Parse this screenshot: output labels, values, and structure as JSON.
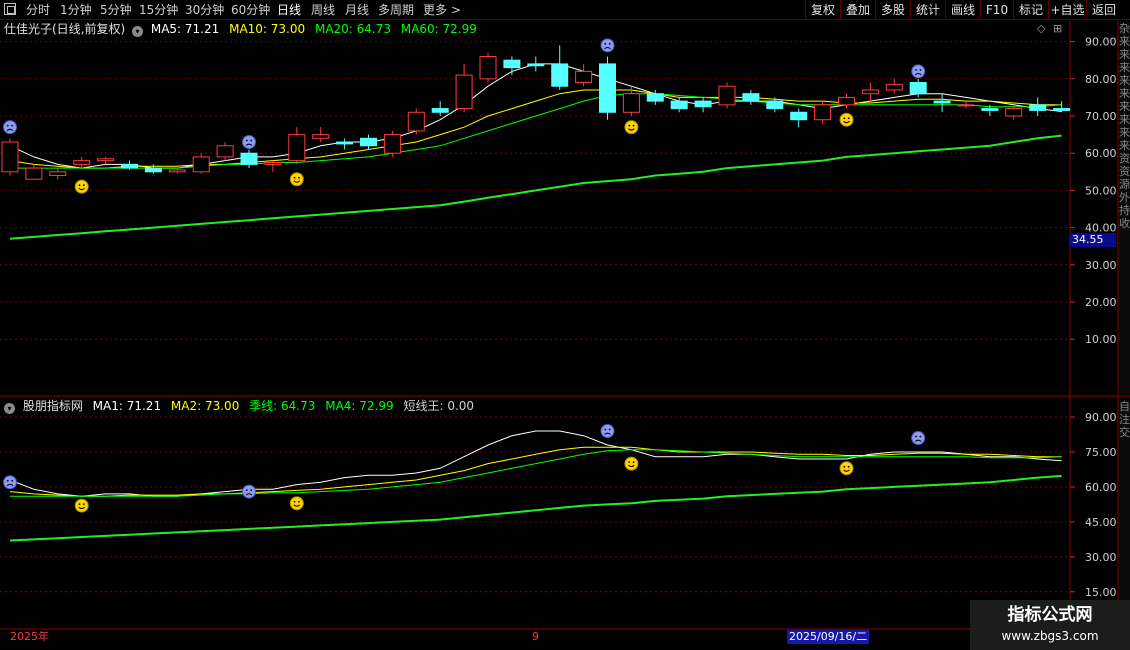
{
  "toolbar": {
    "periods": [
      "分时",
      "1分钟",
      "5分钟",
      "15分钟",
      "30分钟",
      "60分钟",
      "日线",
      "周线",
      "月线",
      "多周期",
      "更多"
    ],
    "active_period": "日线",
    "more_arrow": ">",
    "buttons": [
      "复权",
      "叠加",
      "多股",
      "统计",
      "画线",
      "F10",
      "标记",
      "+自选",
      "返回"
    ]
  },
  "main_panel": {
    "stock_title": "仕佳光子(日线,前复权)",
    "ma_labels": [
      {
        "text": "MA5: 71.21",
        "color": "#ffffff"
      },
      {
        "text": "MA10: 73.00",
        "color": "#ffff00"
      },
      {
        "text": "MA20: 64.73",
        "color": "#00ff00"
      },
      {
        "text": "MA60: 72.99",
        "color": "#00ff00"
      }
    ],
    "y_axis_labels": [
      "90.00",
      "80.00",
      "70.00",
      "60.00",
      "50.00",
      "40.00",
      "30.00",
      "20.00",
      "10.00"
    ],
    "price_tag": "34.55",
    "top_right_icons": [
      "◇",
      "⊞"
    ]
  },
  "sub_panel": {
    "indicator_title": "股朋指标网",
    "labels": [
      {
        "text": "MA1: 71.21",
        "color": "#ffffff"
      },
      {
        "text": "MA2: 73.00",
        "color": "#ffff00"
      },
      {
        "text": "季线: 64.73",
        "color": "#00ff00"
      },
      {
        "text": "MA4: 72.99",
        "color": "#00ff00"
      },
      {
        "text": "短线王: 0.00",
        "color": "#d0d0d0"
      }
    ],
    "y_axis_labels": [
      "90.00",
      "75.00",
      "60.00",
      "45.00",
      "30.00",
      "15.00"
    ]
  },
  "right_strip": {
    "main_text": "杂来来来来来来来来来资资源外持收",
    "sub_text": "自注交"
  },
  "date_bar": {
    "start_label": "2025年",
    "month_label": "9",
    "cursor_date": "2025/09/16/二"
  },
  "watermark": {
    "title": "指标公式网",
    "url": "www.zbgs3.com"
  },
  "colors": {
    "up": "#ff3a3a",
    "down": "#54ffff",
    "ma5": "#ffffff",
    "ma10": "#ffff00",
    "ma20": "#00ff00",
    "ma60": "#22ee22",
    "grid": "#7a0000",
    "axis_text": "#d0d0d0"
  },
  "chart_data": [
    {
      "type": "candlestick",
      "title": "仕佳光子(日线,前复权)",
      "ylim": [
        0,
        95
      ],
      "y_ticks": [
        10,
        20,
        30,
        40,
        50,
        60,
        70,
        80,
        90
      ],
      "candles": [
        {
          "o": 55,
          "c": 63,
          "h": 64,
          "l": 54
        },
        {
          "o": 53,
          "c": 56,
          "h": 57,
          "l": 53
        },
        {
          "o": 54,
          "c": 55,
          "h": 56,
          "l": 53
        },
        {
          "o": 57,
          "c": 58,
          "h": 59,
          "l": 56
        },
        {
          "o": 58,
          "c": 58.5,
          "h": 59,
          "l": 57
        },
        {
          "o": 57,
          "c": 56,
          "h": 58,
          "l": 55.5
        },
        {
          "o": 56,
          "c": 55,
          "h": 57,
          "l": 54.5
        },
        {
          "o": 55,
          "c": 55.5,
          "h": 56,
          "l": 54.5
        },
        {
          "o": 55,
          "c": 59,
          "h": 60,
          "l": 54.5
        },
        {
          "o": 59,
          "c": 62,
          "h": 63,
          "l": 58
        },
        {
          "o": 60,
          "c": 57,
          "h": 61,
          "l": 56
        },
        {
          "o": 57,
          "c": 57.5,
          "h": 58,
          "l": 55
        },
        {
          "o": 58,
          "c": 65,
          "h": 67,
          "l": 57
        },
        {
          "o": 64,
          "c": 65,
          "h": 67,
          "l": 63
        },
        {
          "o": 63,
          "c": 62.5,
          "h": 64,
          "l": 61
        },
        {
          "o": 64,
          "c": 62,
          "h": 65,
          "l": 61
        },
        {
          "o": 60,
          "c": 65,
          "h": 66,
          "l": 59
        },
        {
          "o": 66,
          "c": 71,
          "h": 72,
          "l": 65
        },
        {
          "o": 72,
          "c": 71,
          "h": 74,
          "l": 70
        },
        {
          "o": 72,
          "c": 81,
          "h": 84,
          "l": 71
        },
        {
          "o": 80,
          "c": 86,
          "h": 87,
          "l": 79
        },
        {
          "o": 85,
          "c": 83,
          "h": 86,
          "l": 81
        },
        {
          "o": 84,
          "c": 83.5,
          "h": 86,
          "l": 82
        },
        {
          "o": 84,
          "c": 78,
          "h": 89,
          "l": 77
        },
        {
          "o": 79,
          "c": 82,
          "h": 84,
          "l": 78
        },
        {
          "o": 84,
          "c": 71,
          "h": 86,
          "l": 69
        },
        {
          "o": 71,
          "c": 76,
          "h": 78,
          "l": 70
        },
        {
          "o": 76,
          "c": 74,
          "h": 77,
          "l": 73
        },
        {
          "o": 74,
          "c": 72,
          "h": 75,
          "l": 71
        },
        {
          "o": 74,
          "c": 72.5,
          "h": 75,
          "l": 71
        },
        {
          "o": 73,
          "c": 78,
          "h": 79,
          "l": 72
        },
        {
          "o": 76,
          "c": 74,
          "h": 77,
          "l": 73
        },
        {
          "o": 74,
          "c": 72,
          "h": 75,
          "l": 71
        },
        {
          "o": 71,
          "c": 69,
          "h": 72,
          "l": 67
        },
        {
          "o": 69,
          "c": 73,
          "h": 74,
          "l": 68
        },
        {
          "o": 73,
          "c": 75,
          "h": 76,
          "l": 72
        },
        {
          "o": 76,
          "c": 77,
          "h": 79,
          "l": 74
        },
        {
          "o": 77,
          "c": 78.5,
          "h": 80,
          "l": 76
        },
        {
          "o": 79,
          "c": 76,
          "h": 80,
          "l": 75
        },
        {
          "o": 74,
          "c": 73.5,
          "h": 76,
          "l": 71
        },
        {
          "o": 73,
          "c": 73,
          "h": 74,
          "l": 72
        },
        {
          "o": 72,
          "c": 71.5,
          "h": 73,
          "l": 70
        },
        {
          "o": 70,
          "c": 72,
          "h": 73,
          "l": 69
        },
        {
          "o": 73,
          "c": 71.5,
          "h": 75,
          "l": 70
        },
        {
          "o": 72,
          "c": 71.5,
          "h": 74,
          "l": 71
        }
      ],
      "series": [
        {
          "name": "MA5",
          "values": [
            62,
            59,
            57,
            56,
            57,
            57,
            56,
            56,
            57,
            58,
            59,
            59,
            60,
            62,
            63,
            63,
            64,
            66,
            69,
            73,
            78,
            82,
            84,
            84,
            82,
            80,
            78,
            76,
            74,
            73,
            74,
            74,
            74,
            73,
            72,
            73,
            74,
            75,
            76,
            76,
            75,
            74,
            73,
            72,
            71.2
          ]
        },
        {
          "name": "MA10",
          "values": [
            58,
            57,
            56.5,
            56,
            56,
            56.5,
            56.5,
            56.5,
            57,
            57,
            57.5,
            58,
            58.5,
            59,
            60,
            61,
            62,
            63,
            65,
            67,
            70,
            72,
            74,
            76,
            77,
            77,
            77,
            76,
            75,
            75,
            75,
            75,
            74.5,
            74,
            74,
            73.5,
            73.5,
            74,
            74.5,
            74.5,
            74,
            74,
            73.5,
            73,
            73
          ]
        },
        {
          "name": "MA20",
          "values": [
            56,
            56,
            56,
            56,
            56,
            56,
            56,
            56,
            56.5,
            57,
            57,
            57.5,
            57.5,
            58,
            58.5,
            59,
            60,
            61,
            62,
            64,
            66,
            68,
            70,
            72,
            74,
            75.5,
            76,
            76,
            75.5,
            75,
            74.5,
            74,
            73.5,
            73,
            73,
            73,
            73,
            73,
            73,
            73,
            73,
            72.5,
            72.5,
            72.5,
            73
          ]
        },
        {
          "name": "MA60",
          "values": [
            37,
            37.5,
            38,
            38.5,
            39,
            39.5,
            40,
            40.5,
            41,
            41.5,
            42,
            42.5,
            43,
            43.5,
            44,
            44.5,
            45,
            45.5,
            46,
            47,
            48,
            49,
            50,
            51,
            52,
            52.5,
            53,
            54,
            54.5,
            55,
            56,
            56.5,
            57,
            57.5,
            58,
            59,
            59.5,
            60,
            60.5,
            61,
            61.5,
            62,
            63,
            64,
            64.73
          ]
        }
      ]
    },
    {
      "type": "line",
      "title": "股朋指标网",
      "ylim": [
        10,
        95
      ],
      "y_ticks": [
        15,
        30,
        45,
        60,
        75,
        90
      ],
      "series": [
        {
          "name": "MA1",
          "values": [
            63,
            59,
            57,
            56,
            57,
            57,
            56,
            56,
            57,
            58,
            59,
            59,
            61,
            62,
            64,
            65,
            65,
            66,
            68,
            73,
            78,
            82,
            84,
            84,
            82,
            78,
            76,
            73,
            73,
            73,
            74,
            74,
            73,
            72,
            72,
            72,
            74,
            75,
            75,
            75,
            74,
            73,
            73,
            72,
            71.21
          ]
        },
        {
          "name": "MA2",
          "values": [
            58,
            57,
            56.5,
            56,
            56,
            56.5,
            56.5,
            56.5,
            57,
            57,
            57.5,
            58,
            58.5,
            59,
            60,
            61,
            62,
            63,
            65,
            67,
            70,
            72,
            74,
            76,
            77,
            77,
            77,
            76,
            75,
            75,
            75,
            75,
            74.5,
            74,
            74,
            73.5,
            73.5,
            74,
            74.5,
            74.5,
            74,
            74,
            73.5,
            73,
            73
          ]
        },
        {
          "name": "季线",
          "values": [
            56,
            56,
            56,
            56,
            56,
            56,
            56,
            56,
            56.5,
            57,
            57,
            57.5,
            57.5,
            58,
            58.5,
            59,
            60,
            61,
            62,
            64,
            66,
            68,
            70,
            72,
            74,
            75.5,
            76,
            76,
            75.5,
            75,
            74.5,
            74,
            73.5,
            73,
            73,
            73,
            73,
            73,
            73,
            73,
            73,
            72.5,
            72.5,
            72.5,
            72.99
          ]
        },
        {
          "name": "MA4",
          "values": [
            37,
            37.5,
            38,
            38.5,
            39,
            39.5,
            40,
            40.5,
            41,
            41.5,
            42,
            42.5,
            43,
            43.5,
            44,
            44.5,
            45,
            45.5,
            46,
            47,
            48,
            49,
            50,
            51,
            52,
            52.5,
            53,
            54,
            54.5,
            55,
            56,
            56.5,
            57,
            57.5,
            58,
            59,
            59.5,
            60,
            60.5,
            61,
            61.5,
            62,
            63,
            64,
            64.73
          ]
        }
      ]
    }
  ],
  "signals": {
    "main_sad": [
      {
        "i": 0,
        "v": 67
      },
      {
        "i": 10,
        "v": 63
      },
      {
        "i": 25,
        "v": 89
      },
      {
        "i": 38,
        "v": 82
      }
    ],
    "main_happy": [
      {
        "i": 3,
        "v": 51
      },
      {
        "i": 12,
        "v": 53
      },
      {
        "i": 26,
        "v": 67
      },
      {
        "i": 35,
        "v": 69
      }
    ],
    "sub_sad": [
      {
        "i": 0,
        "v": 62
      },
      {
        "i": 10,
        "v": 58
      },
      {
        "i": 25,
        "v": 84
      },
      {
        "i": 38,
        "v": 81
      }
    ],
    "sub_happy": [
      {
        "i": 3,
        "v": 52
      },
      {
        "i": 12,
        "v": 53
      },
      {
        "i": 26,
        "v": 70
      },
      {
        "i": 35,
        "v": 68
      }
    ]
  }
}
